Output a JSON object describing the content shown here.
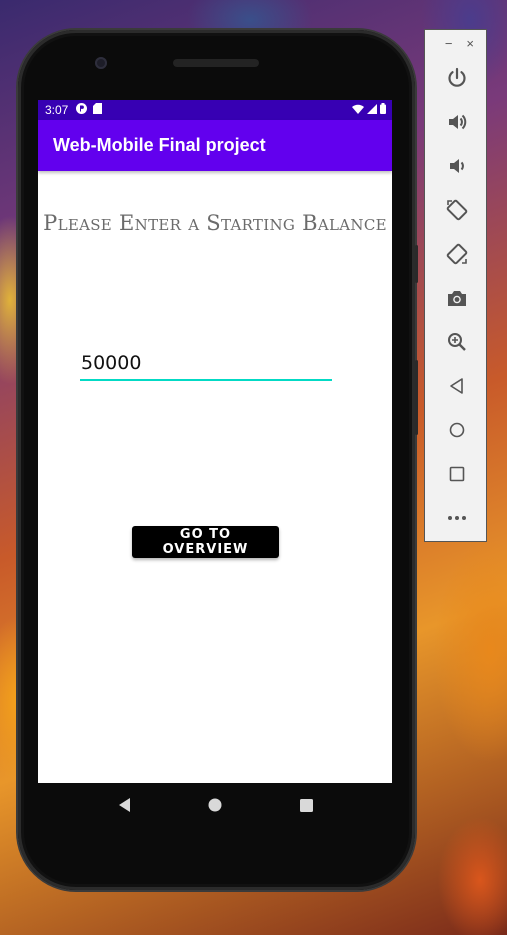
{
  "status_bar": {
    "time": "3:07",
    "icons": [
      "notification-p-icon",
      "sd-card-icon",
      "wifi-icon",
      "signal-icon",
      "battery-icon"
    ]
  },
  "app_bar": {
    "title": "Web-Mobile Final project"
  },
  "main": {
    "prompt": "Please Enter a Starting Balance",
    "balance_value": "50000",
    "go_button_label": "GO TO OVERVIEW"
  },
  "nav_bar": {
    "buttons": [
      "back",
      "home",
      "recents"
    ]
  },
  "emulator_panel": {
    "minimize": "−",
    "close": "×",
    "tools": [
      "power",
      "volume-up",
      "volume-down",
      "rotate-left",
      "rotate-right",
      "screenshot",
      "zoom",
      "back",
      "home",
      "overview",
      "more"
    ]
  },
  "colors": {
    "status_bar": "#3700b3",
    "app_bar": "#6200ee",
    "accent": "#03dac5",
    "button": "#000000"
  }
}
